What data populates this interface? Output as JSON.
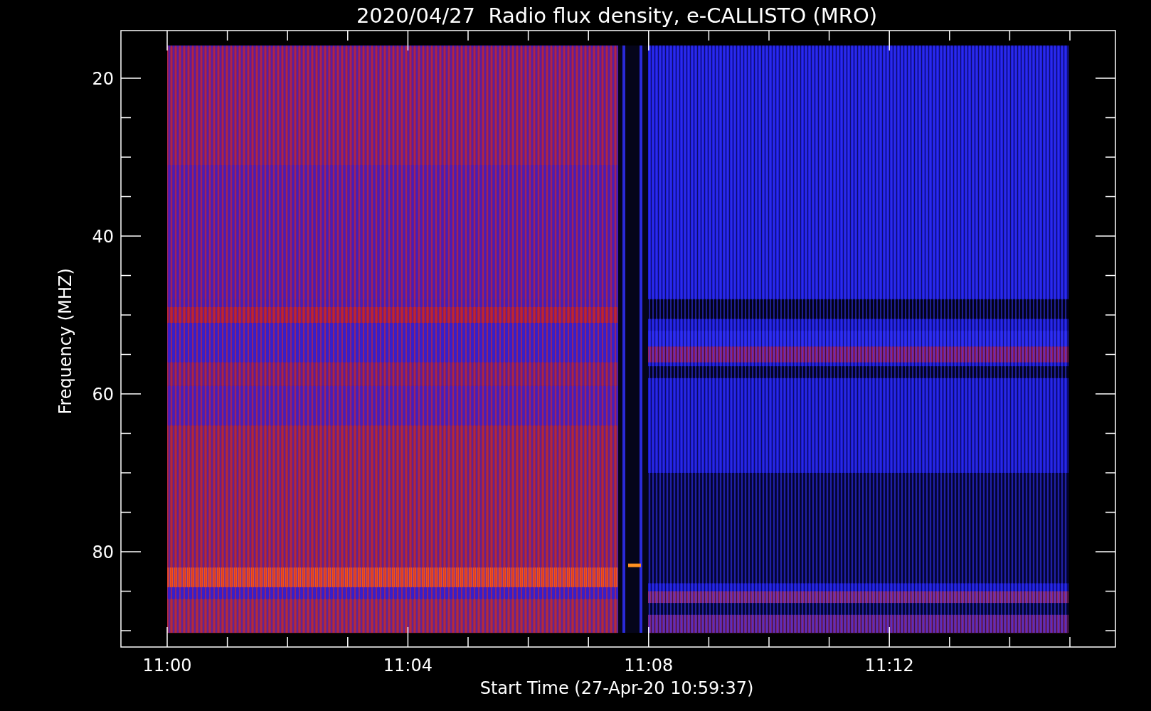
{
  "title": "2020/04/27  Radio flux density, e-CALLISTO (MRO)",
  "ylabel": "Frequency (MHZ)",
  "xlabel": "Start Time (27-Apr-20 10:59:37)",
  "yticks": [
    "20",
    "40",
    "60",
    "80"
  ],
  "xticks": [
    "11:00",
    "11:04",
    "11:08",
    "11:12"
  ]
}
